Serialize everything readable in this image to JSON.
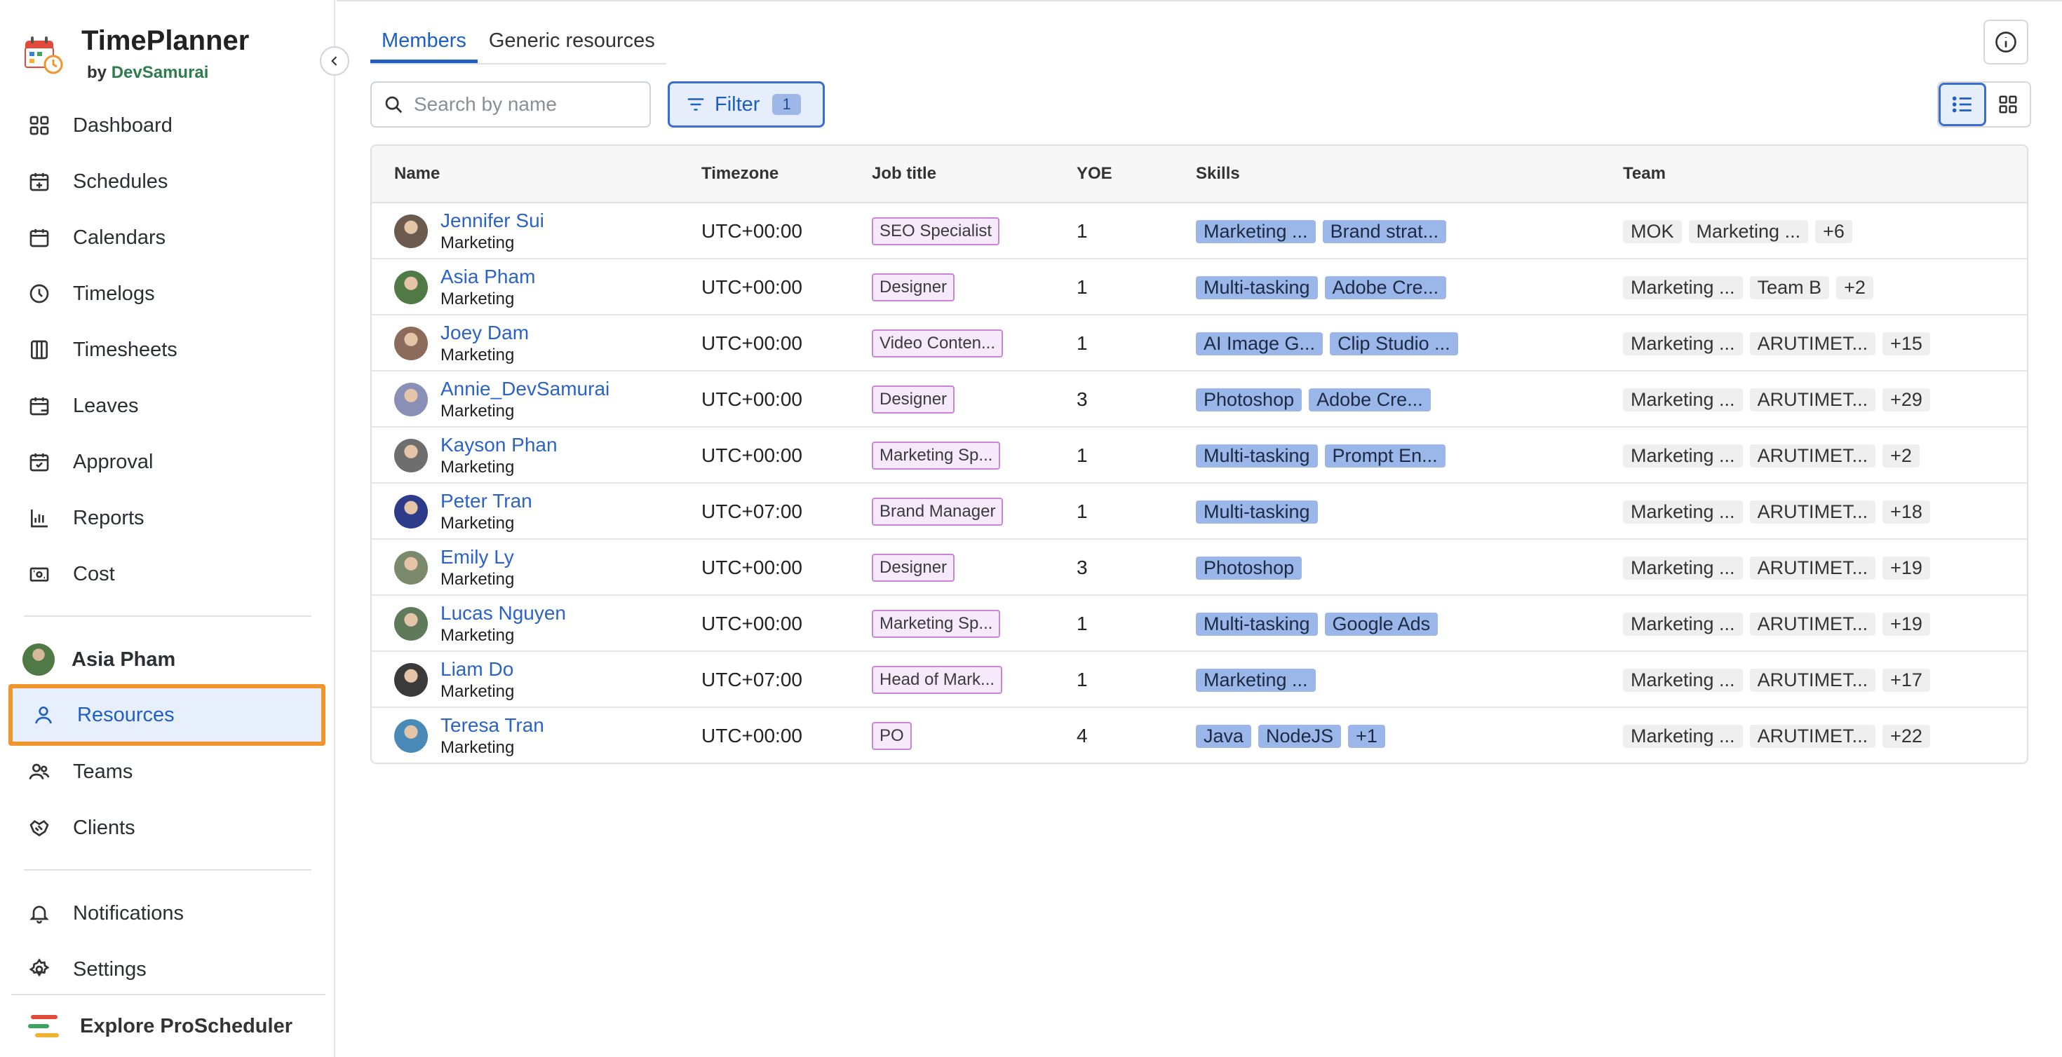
{
  "brand": {
    "title": "TimePlanner",
    "by": "by",
    "company": "DevSamurai"
  },
  "sidebar": {
    "nav": [
      {
        "label": "Dashboard",
        "icon": "dashboard-icon"
      },
      {
        "label": "Schedules",
        "icon": "calendar-plus-icon"
      },
      {
        "label": "Calendars",
        "icon": "calendar-icon"
      },
      {
        "label": "Timelogs",
        "icon": "clock-icon"
      },
      {
        "label": "Timesheets",
        "icon": "columns-icon"
      },
      {
        "label": "Leaves",
        "icon": "calendar-leave-icon"
      },
      {
        "label": "Approval",
        "icon": "calendar-check-icon"
      },
      {
        "label": "Reports",
        "icon": "bar-chart-icon"
      },
      {
        "label": "Cost",
        "icon": "money-icon"
      }
    ],
    "user": {
      "name": "Asia Pham"
    },
    "nav2": [
      {
        "label": "Resources",
        "icon": "person-icon",
        "active": true
      },
      {
        "label": "Teams",
        "icon": "people-icon"
      },
      {
        "label": "Clients",
        "icon": "handshake-icon"
      }
    ],
    "nav3": [
      {
        "label": "Notifications",
        "icon": "bell-icon"
      },
      {
        "label": "Settings",
        "icon": "gear-icon"
      }
    ],
    "explore": "Explore ProScheduler"
  },
  "tabs": [
    {
      "label": "Members",
      "active": true
    },
    {
      "label": "Generic resources"
    }
  ],
  "search": {
    "placeholder": "Search by name"
  },
  "filter": {
    "label": "Filter",
    "count": "1"
  },
  "table": {
    "headers": {
      "name": "Name",
      "timezone": "Timezone",
      "job": "Job title",
      "yoe": "YOE",
      "skills": "Skills",
      "team": "Team"
    },
    "rows": [
      {
        "name": "Jennifer Sui",
        "dept": "Marketing",
        "tz": "UTC+00:00",
        "job": "SEO Specialist",
        "yoe": "1",
        "skills": [
          "Marketing ...",
          "Brand strat..."
        ],
        "teams": [
          "MOK",
          "Marketing ...",
          "+6"
        ],
        "avatar_color": "#6d5a4e"
      },
      {
        "name": "Asia Pham",
        "dept": "Marketing",
        "tz": "UTC+00:00",
        "job": "Designer",
        "yoe": "1",
        "skills": [
          "Multi-tasking",
          "Adobe Cre..."
        ],
        "teams": [
          "Marketing ...",
          "Team B",
          "+2"
        ],
        "avatar_color": "#4f7a46"
      },
      {
        "name": "Joey Dam",
        "dept": "Marketing",
        "tz": "UTC+00:00",
        "job": "Video Conten...",
        "yoe": "1",
        "skills": [
          "AI Image G...",
          "Clip Studio ..."
        ],
        "teams": [
          "Marketing ...",
          "ARUTIMET...",
          "+15"
        ],
        "avatar_color": "#8c6b5a"
      },
      {
        "name": "Annie_DevSamurai",
        "dept": "Marketing",
        "tz": "UTC+00:00",
        "job": "Designer",
        "yoe": "3",
        "skills": [
          "Photoshop",
          "Adobe Cre..."
        ],
        "teams": [
          "Marketing ...",
          "ARUTIMET...",
          "+29"
        ],
        "avatar_color": "#8a8fb8"
      },
      {
        "name": "Kayson Phan",
        "dept": "Marketing",
        "tz": "UTC+00:00",
        "job": "Marketing Sp...",
        "yoe": "1",
        "skills": [
          "Multi-tasking",
          "Prompt En..."
        ],
        "teams": [
          "Marketing ...",
          "ARUTIMET...",
          "+2"
        ],
        "avatar_color": "#6e6e6e"
      },
      {
        "name": "Peter Tran",
        "dept": "Marketing",
        "tz": "UTC+07:00",
        "job": "Brand Manager",
        "yoe": "1",
        "skills": [
          "Multi-tasking"
        ],
        "teams": [
          "Marketing ...",
          "ARUTIMET...",
          "+18"
        ],
        "avatar_color": "#2d3c8a"
      },
      {
        "name": "Emily Ly",
        "dept": "Marketing",
        "tz": "UTC+00:00",
        "job": "Designer",
        "yoe": "3",
        "skills": [
          "Photoshop"
        ],
        "teams": [
          "Marketing ...",
          "ARUTIMET...",
          "+19"
        ],
        "avatar_color": "#7a8a6a"
      },
      {
        "name": "Lucas Nguyen",
        "dept": "Marketing",
        "tz": "UTC+00:00",
        "job": "Marketing Sp...",
        "yoe": "1",
        "skills": [
          "Multi-tasking",
          "Google Ads"
        ],
        "teams": [
          "Marketing ...",
          "ARUTIMET...",
          "+19"
        ],
        "avatar_color": "#5e7a5a"
      },
      {
        "name": "Liam Do",
        "dept": "Marketing",
        "tz": "UTC+07:00",
        "job": "Head of Mark...",
        "yoe": "1",
        "skills": [
          "Marketing ..."
        ],
        "teams": [
          "Marketing ...",
          "ARUTIMET...",
          "+17"
        ],
        "avatar_color": "#3a3a3a"
      },
      {
        "name": "Teresa Tran",
        "dept": "Marketing",
        "tz": "UTC+00:00",
        "job": "PO",
        "yoe": "4",
        "skills": [
          "Java",
          "NodeJS",
          "+1"
        ],
        "teams": [
          "Marketing ...",
          "ARUTIMET...",
          "+22"
        ],
        "avatar_color": "#4a8ab8"
      }
    ]
  },
  "colors": {
    "accent": "#1f5fc4",
    "highlight": "#f2942c",
    "skill_chip": "#9bb7ea",
    "job_chip_border": "#c687d8"
  }
}
